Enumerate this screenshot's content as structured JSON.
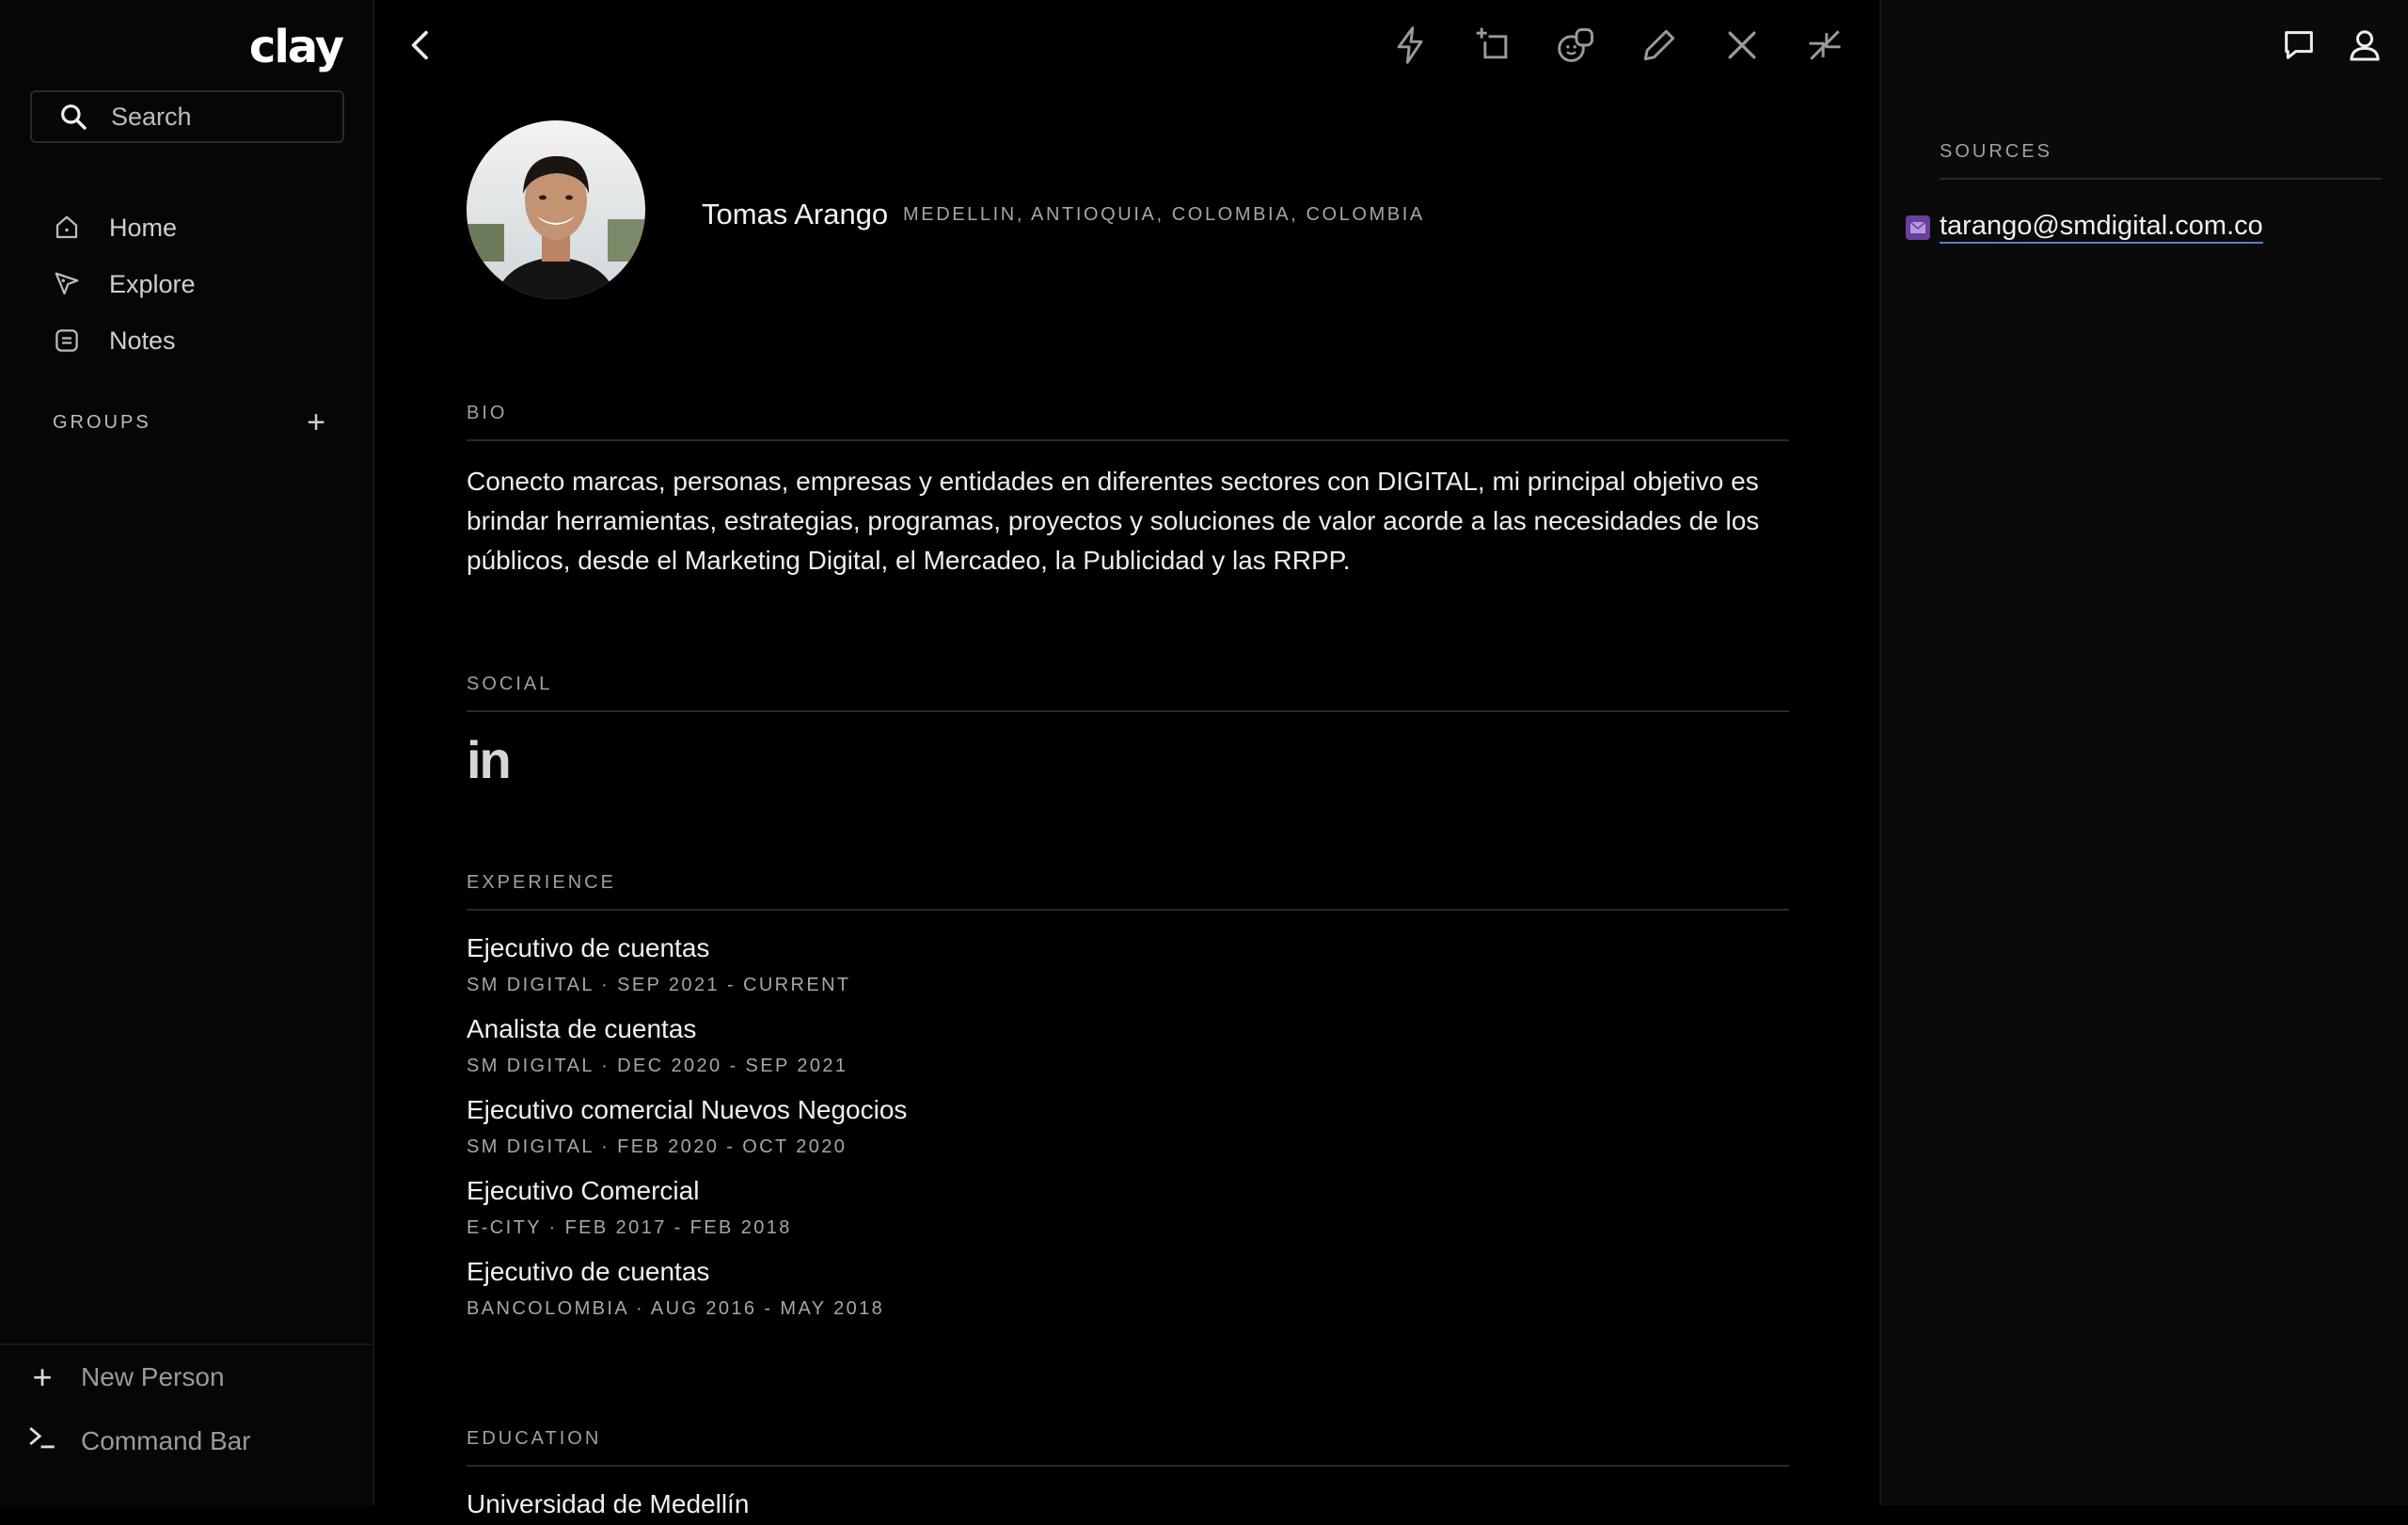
{
  "app": {
    "logo": "clay"
  },
  "sidebar": {
    "search_placeholder": "Search",
    "nav": [
      {
        "label": "Home",
        "icon": "home-icon"
      },
      {
        "label": "Explore",
        "icon": "explore-icon"
      },
      {
        "label": "Notes",
        "icon": "notes-icon"
      }
    ],
    "groups_label": "GROUPS",
    "bottom": [
      {
        "label": "New Person",
        "icon": "plus-icon"
      },
      {
        "label": "Command Bar",
        "icon": "terminal-icon"
      }
    ]
  },
  "toolbar": {
    "icons": [
      "bolt-icon",
      "add-to-group-icon",
      "faces-icon",
      "edit-icon",
      "close-icon",
      "collapse-icon"
    ]
  },
  "person": {
    "name": "Tomas Arango",
    "location": "MEDELLIN, ANTIOQUIA, COLOMBIA, COLOMBIA"
  },
  "bio": {
    "title": "BIO",
    "text": "Conecto marcas, personas, empresas y entidades en diferentes sectores con DIGITAL, mi principal objetivo es  brindar herramientas, estrategias, programas, proyectos y soluciones de valor acorde a las necesidades de los públicos, desde el Marketing Digital, el Mercadeo, la Publicidad y las RRPP."
  },
  "social": {
    "title": "SOCIAL",
    "linkedin": "in"
  },
  "experience": {
    "title": "EXPERIENCE",
    "items": [
      {
        "role": "Ejecutivo de cuentas",
        "meta": "SM DIGITAL  ·  SEP 2021 - CURRENT"
      },
      {
        "role": "Analista de cuentas",
        "meta": "SM DIGITAL  ·  DEC 2020 - SEP 2021"
      },
      {
        "role": "Ejecutivo comercial Nuevos Negocios",
        "meta": "SM DIGITAL  ·  FEB 2020 - OCT 2020"
      },
      {
        "role": "Ejecutivo Comercial",
        "meta": "E-CITY  ·  FEB 2017 - FEB 2018"
      },
      {
        "role": "Ejecutivo de cuentas",
        "meta": "BANCOLOMBIA  ·  AUG 2016 - MAY 2018"
      }
    ]
  },
  "education": {
    "title": "EDUCATION",
    "first_item": "Universidad de Medellín"
  },
  "sources": {
    "title": "SOURCES",
    "email": "tarango@smdigital.com.co"
  },
  "colors": {
    "accent_mail": "#6a3fa0",
    "link_underline": "#5b7fb8"
  }
}
